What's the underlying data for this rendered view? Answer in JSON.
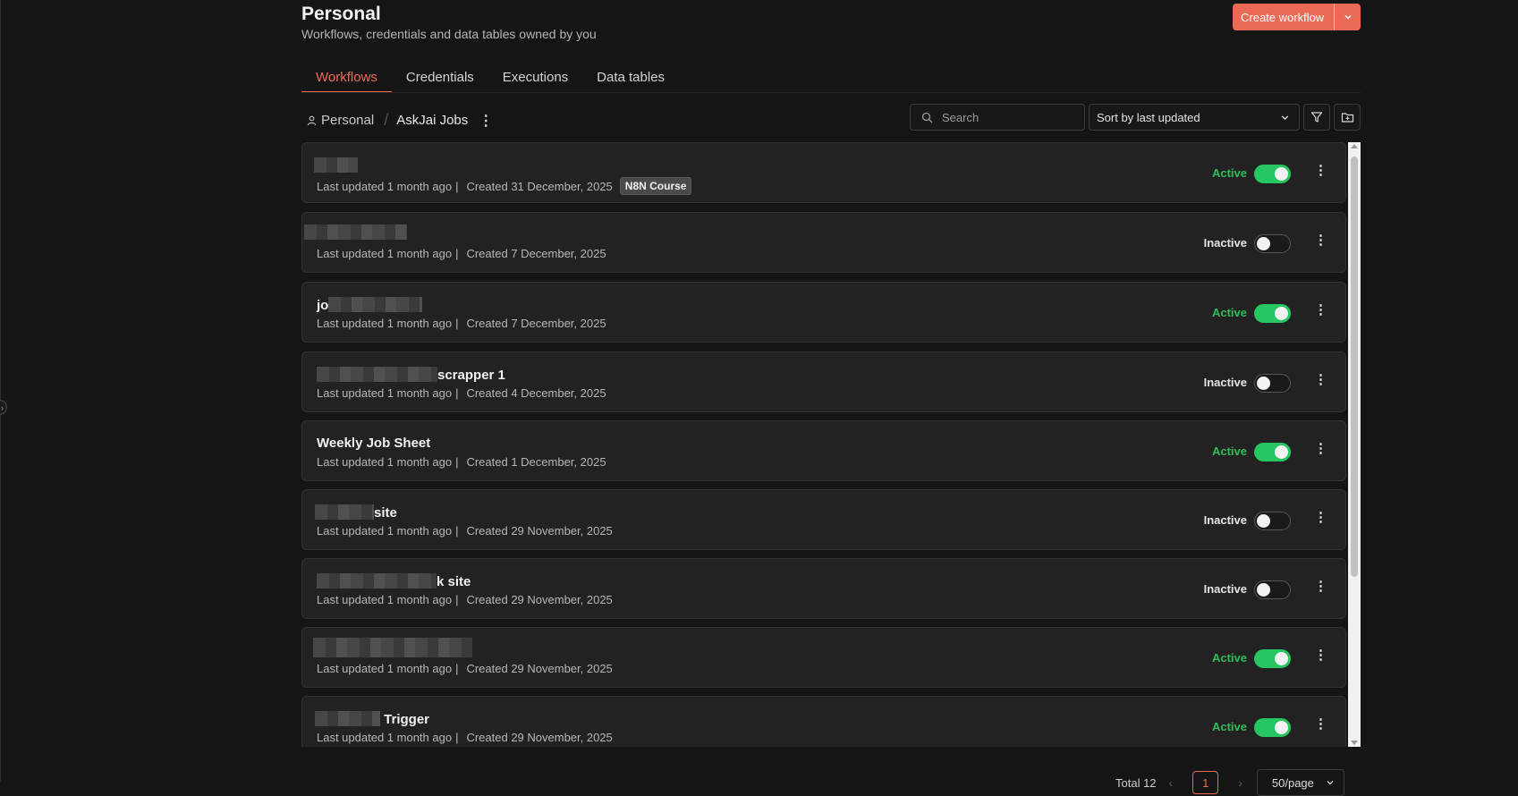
{
  "header": {
    "title": "Personal",
    "subtitle": "Workflows, credentials and data tables owned by you",
    "create_label": "Create workflow"
  },
  "tabs": [
    {
      "label": "Workflows",
      "active": true
    },
    {
      "label": "Credentials",
      "active": false
    },
    {
      "label": "Executions",
      "active": false
    },
    {
      "label": "Data tables",
      "active": false
    }
  ],
  "breadcrumb": {
    "root": "Personal",
    "folder": "AskJai Jobs"
  },
  "search": {
    "placeholder": "Search"
  },
  "sort": {
    "value": "Sort by last updated"
  },
  "workflows": [
    {
      "name_visible": "",
      "last_updated": "Last updated 1 month ago",
      "created": "Created 31 December, 2025",
      "tag": "N8N Course",
      "status": "Active",
      "active": true
    },
    {
      "name_visible": "",
      "last_updated": "Last updated 1 month ago",
      "created": "Created 7 December, 2025",
      "tag": "",
      "status": "Inactive",
      "active": false
    },
    {
      "name_visible": "jo",
      "last_updated": "Last updated 1 month ago",
      "created": "Created 7 December, 2025",
      "tag": "",
      "status": "Active",
      "active": true
    },
    {
      "name_visible": "scrapper 1",
      "last_updated": "Last updated 1 month ago",
      "created": "Created 4 December, 2025",
      "tag": "",
      "status": "Inactive",
      "active": false
    },
    {
      "name_visible": "Weekly Job Sheet",
      "last_updated": "Last updated 1 month ago",
      "created": "Created 1 December, 2025",
      "tag": "",
      "status": "Active",
      "active": true
    },
    {
      "name_visible": "site",
      "last_updated": "Last updated 1 month ago",
      "created": "Created 29 November, 2025",
      "tag": "",
      "status": "Inactive",
      "active": false
    },
    {
      "name_visible": "k site",
      "last_updated": "Last updated 1 month ago",
      "created": "Created 29 November, 2025",
      "tag": "",
      "status": "Inactive",
      "active": false
    },
    {
      "name_visible": "",
      "last_updated": "Last updated 1 month ago",
      "created": "Created 29 November, 2025",
      "tag": "",
      "status": "Active",
      "active": true
    },
    {
      "name_visible": "Trigger",
      "last_updated": "Last updated 1 month ago",
      "created": "Created 29 November, 2025",
      "tag": "",
      "status": "Active",
      "active": true
    }
  ],
  "pagination": {
    "total": "Total 12",
    "current_page": "1",
    "page_size": "50/page"
  },
  "colors": {
    "accent": "#ea6a55",
    "active_green": "#26c661",
    "background": "#151515",
    "card": "#222222"
  }
}
